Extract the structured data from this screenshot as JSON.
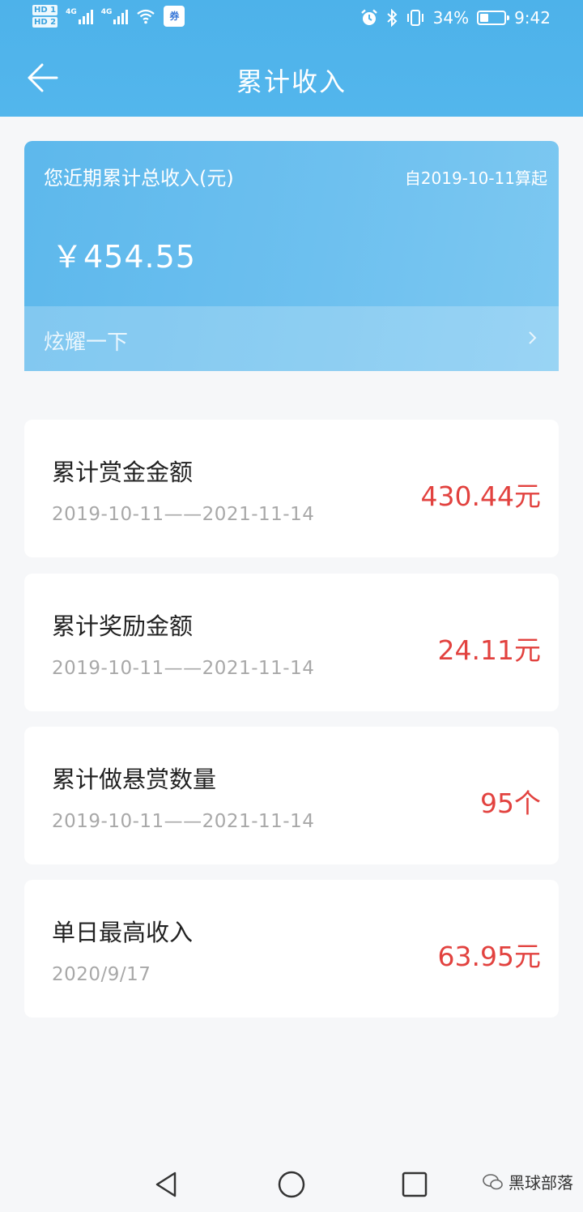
{
  "status_bar": {
    "hd1": "HD 1",
    "hd2": "HD 2",
    "signal1_label": "4G",
    "signal2_label": "4G",
    "app_badge": "券",
    "battery_text": "34%",
    "battery_level": 0.34,
    "time": "9:42"
  },
  "header": {
    "title": "累计收入"
  },
  "summary": {
    "label": "您近期累计总收入(元)",
    "since": "自2019-10-11算起",
    "amount": "￥454.55",
    "show_off": "炫耀一下"
  },
  "stats": [
    {
      "title": "累计赏金金额",
      "range": "2019-10-11——2021-11-14",
      "value": "430.44元"
    },
    {
      "title": "累计奖励金额",
      "range": "2019-10-11——2021-11-14",
      "value": "24.11元"
    },
    {
      "title": "累计做悬赏数量",
      "range": "2019-10-11——2021-11-14",
      "value": "95个"
    },
    {
      "title": "单日最高收入",
      "range": "2020/9/17",
      "value": "63.95元"
    }
  ],
  "watermark": {
    "text": "黑球部落"
  },
  "colors": {
    "header": "#4db2ea",
    "value_red": "#e2423f",
    "background": "#f6f7f9"
  },
  "icons": {
    "back": "arrow-left-icon",
    "chevron": "chevron-right-icon",
    "nav_back": "triangle-back-icon",
    "nav_home": "circle-home-icon",
    "nav_recent": "square-recent-icon"
  }
}
